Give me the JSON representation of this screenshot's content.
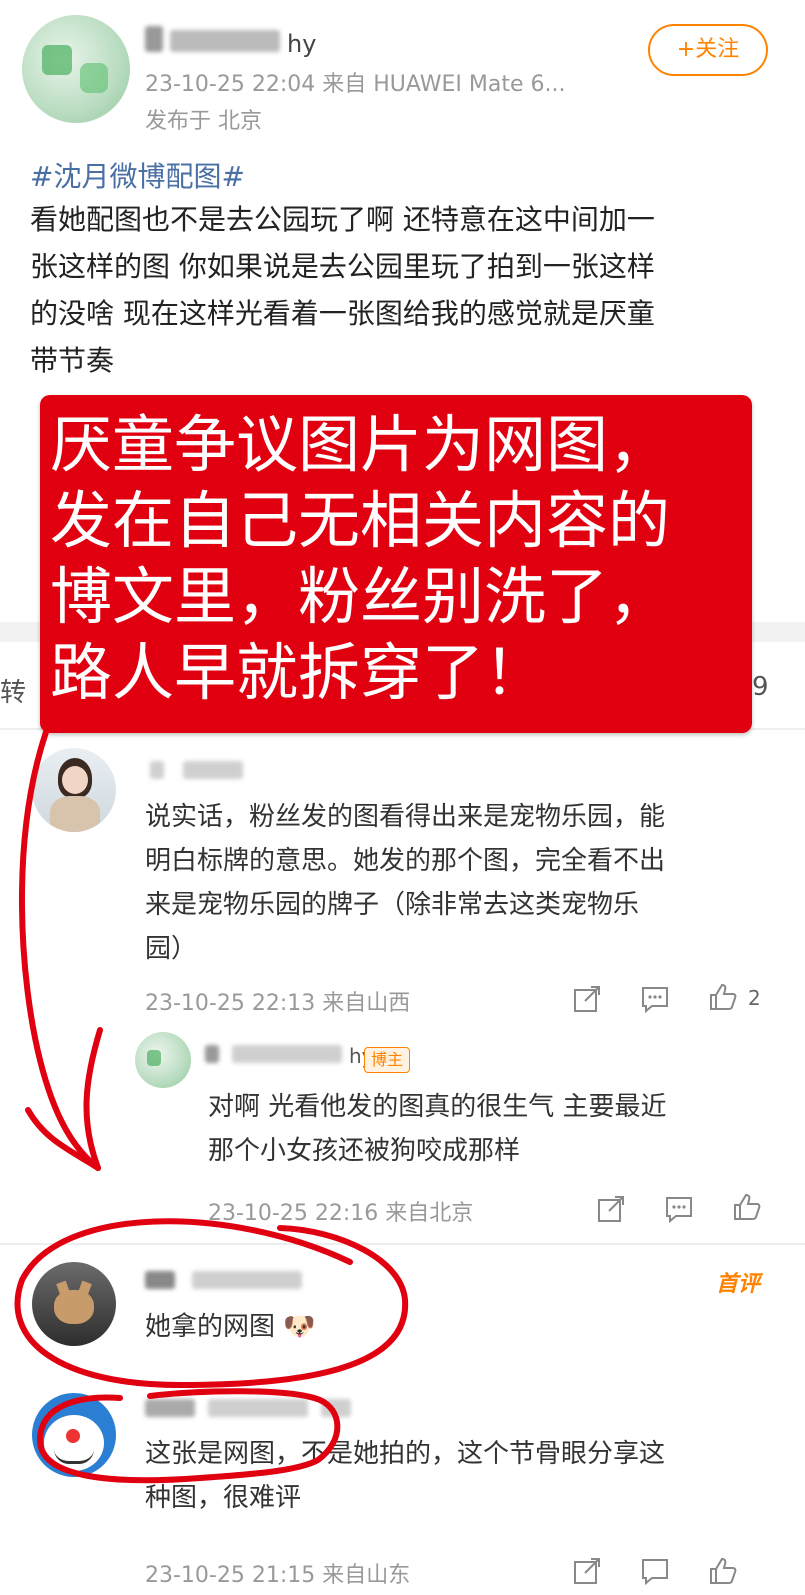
{
  "post": {
    "author_suffix": "hy",
    "time_source": "23-10-25 22:04  来自 HUAWEI Mate 6...",
    "location": "发布于 北京",
    "follow_label": "+关注",
    "hashtag": "#沈月微博配图#",
    "body_lines": [
      "看她配图也不是去公园玩了啊 还特意在这中间加一",
      "张这样的图 你如果说是去公园里玩了拍到一张这样",
      "的没啥 现在这样光看着一张图给我的感觉就是厌童",
      "带节奏"
    ]
  },
  "overlay": {
    "lines": [
      "厌童争议图片为网图，",
      "发在自己无相关内容的",
      "博文里，粉丝别洗了，",
      "路人早就拆穿了！"
    ],
    "bg_color": "#e00010"
  },
  "tabs_partial": {
    "left_char": "转",
    "right_char": "9"
  },
  "comments": [
    {
      "lines": [
        "说实话，粉丝发的图看得出来是宠物乐园，能",
        "明白标牌的意思。她发的那个图，完全看不出",
        "来是宠物乐园的牌子（除非常去这类宠物乐",
        "园）"
      ],
      "meta": "23-10-25 22:13 来自山西",
      "likes": "2"
    },
    {
      "badge": "博主",
      "name_suffix": "hy",
      "lines": [
        "对啊 光看他发的图真的很生气 主要最近",
        "那个小女孩还被狗咬成那样"
      ],
      "meta": "23-10-25 22:16 来自北京"
    },
    {
      "tag": "首评",
      "lines": [
        "她拿的网图"
      ],
      "emoji": "🐶"
    },
    {
      "lines": [
        "这张是网图，不是她拍的，这个节骨眼分享这",
        "种图，很难评"
      ],
      "meta": "23-10-25 21:15 来自山东"
    }
  ],
  "colors": {
    "link_blue": "#4a6fa5",
    "accent_orange": "#ff8200",
    "annotation_red": "#e00010"
  }
}
